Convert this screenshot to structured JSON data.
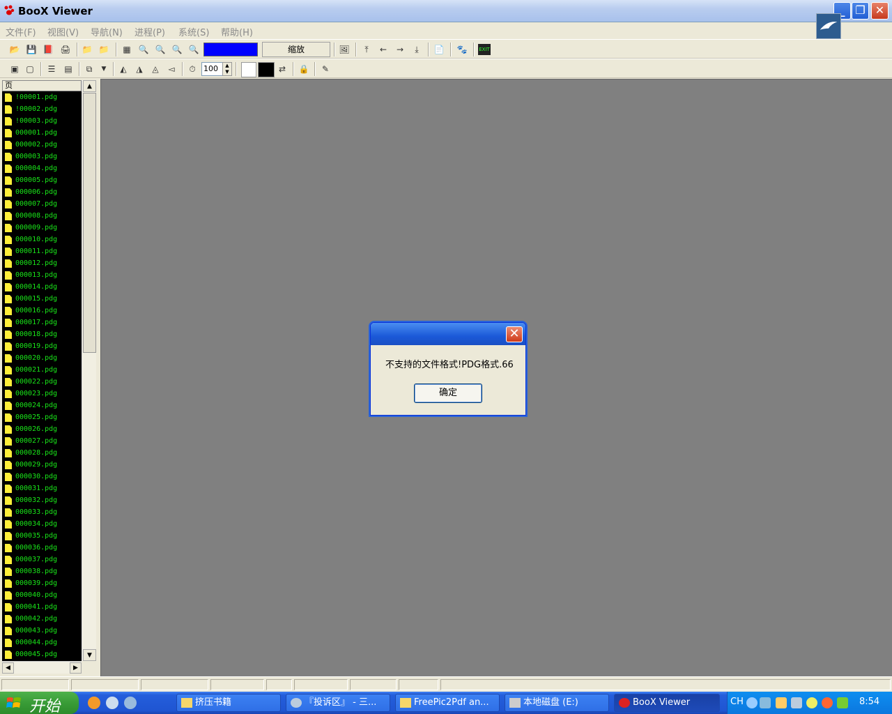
{
  "window": {
    "title": "BooX Viewer"
  },
  "menu": [
    {
      "label": "文件(F)"
    },
    {
      "label": "视图(V)"
    },
    {
      "label": "导航(N)"
    },
    {
      "label": "进程(P)"
    },
    {
      "label": "系统(S)"
    },
    {
      "label": "帮助(H)"
    }
  ],
  "toolbar": {
    "zoom_label": "缩放",
    "zoom_value": "100",
    "color_accent": "#0000ff"
  },
  "filelist": {
    "header": "页",
    "files": [
      "!00001.pdg",
      "!00002.pdg",
      "!00003.pdg",
      "000001.pdg",
      "000002.pdg",
      "000003.pdg",
      "000004.pdg",
      "000005.pdg",
      "000006.pdg",
      "000007.pdg",
      "000008.pdg",
      "000009.pdg",
      "000010.pdg",
      "000011.pdg",
      "000012.pdg",
      "000013.pdg",
      "000014.pdg",
      "000015.pdg",
      "000016.pdg",
      "000017.pdg",
      "000018.pdg",
      "000019.pdg",
      "000020.pdg",
      "000021.pdg",
      "000022.pdg",
      "000023.pdg",
      "000024.pdg",
      "000025.pdg",
      "000026.pdg",
      "000027.pdg",
      "000028.pdg",
      "000029.pdg",
      "000030.pdg",
      "000031.pdg",
      "000032.pdg",
      "000033.pdg",
      "000034.pdg",
      "000035.pdg",
      "000036.pdg",
      "000037.pdg",
      "000038.pdg",
      "000039.pdg",
      "000040.pdg",
      "000041.pdg",
      "000042.pdg",
      "000043.pdg",
      "000044.pdg",
      "000045.pdg"
    ]
  },
  "dialog": {
    "message": "不支持的文件格式!PDG格式.66",
    "ok_label": "确定"
  },
  "taskbar": {
    "start_label": "开始",
    "tasks": [
      {
        "label": "挤压书籍"
      },
      {
        "label": "『投诉区』 - 三..."
      },
      {
        "label": "FreePic2Pdf an..."
      },
      {
        "label": "本地磁盘 (E:)"
      },
      {
        "label": "BooX Viewer"
      }
    ],
    "lang": "CH",
    "clock": "8:54"
  }
}
